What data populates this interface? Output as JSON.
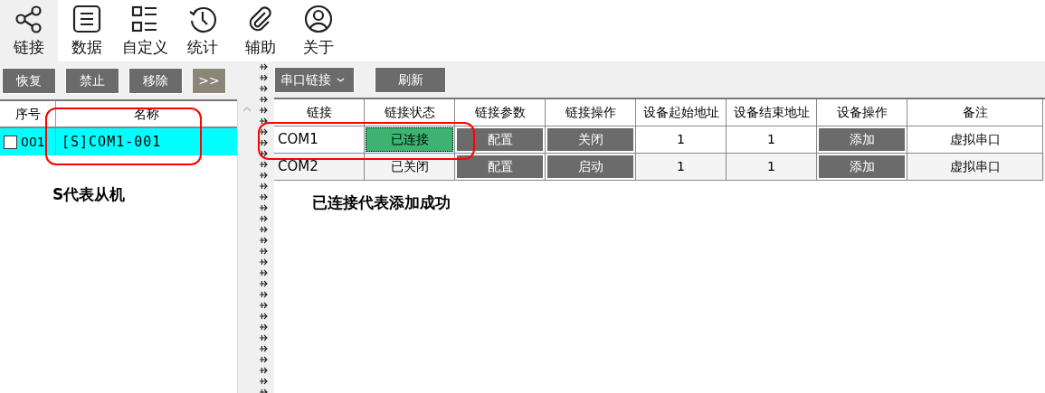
{
  "toolbar": [
    {
      "label": "链接",
      "selected": true
    },
    {
      "label": "数据",
      "selected": false
    },
    {
      "label": "自定义",
      "selected": false
    },
    {
      "label": "统计",
      "selected": false
    },
    {
      "label": "辅助",
      "selected": false
    },
    {
      "label": "关于",
      "selected": false
    }
  ],
  "left_panel": {
    "buttons": [
      {
        "label": "恢复",
        "kind": "plain"
      },
      {
        "label": "禁止",
        "kind": "plain"
      },
      {
        "label": "移除",
        "kind": "plain"
      },
      {
        "label": ">>",
        "kind": "accent"
      }
    ],
    "columns": [
      "序号",
      "名称"
    ],
    "rows": [
      {
        "checked": false,
        "index": "001",
        "name": "[S]COM1-001",
        "selected": true
      }
    ],
    "note": "S代表从机"
  },
  "right_panel": {
    "link_type": "串口链接",
    "refresh": "刷新",
    "columns": [
      "链接",
      "链接状态",
      "链接参数",
      "链接操作",
      "设备起始地址",
      "设备结束地址",
      "设备操作",
      "备注"
    ],
    "rows": [
      {
        "link": "COM1",
        "status": "已连接",
        "connected": true,
        "params": "配置",
        "operation": "关闭",
        "start": "1",
        "end": "1",
        "device_op": "添加",
        "note": "虚拟串口"
      },
      {
        "link": "COM2",
        "status": "已关闭",
        "connected": false,
        "params": "配置",
        "operation": "启动",
        "start": "1",
        "end": "1",
        "device_op": "添加",
        "note": "虚拟串口"
      }
    ],
    "note": "已连接代表添加成功"
  }
}
